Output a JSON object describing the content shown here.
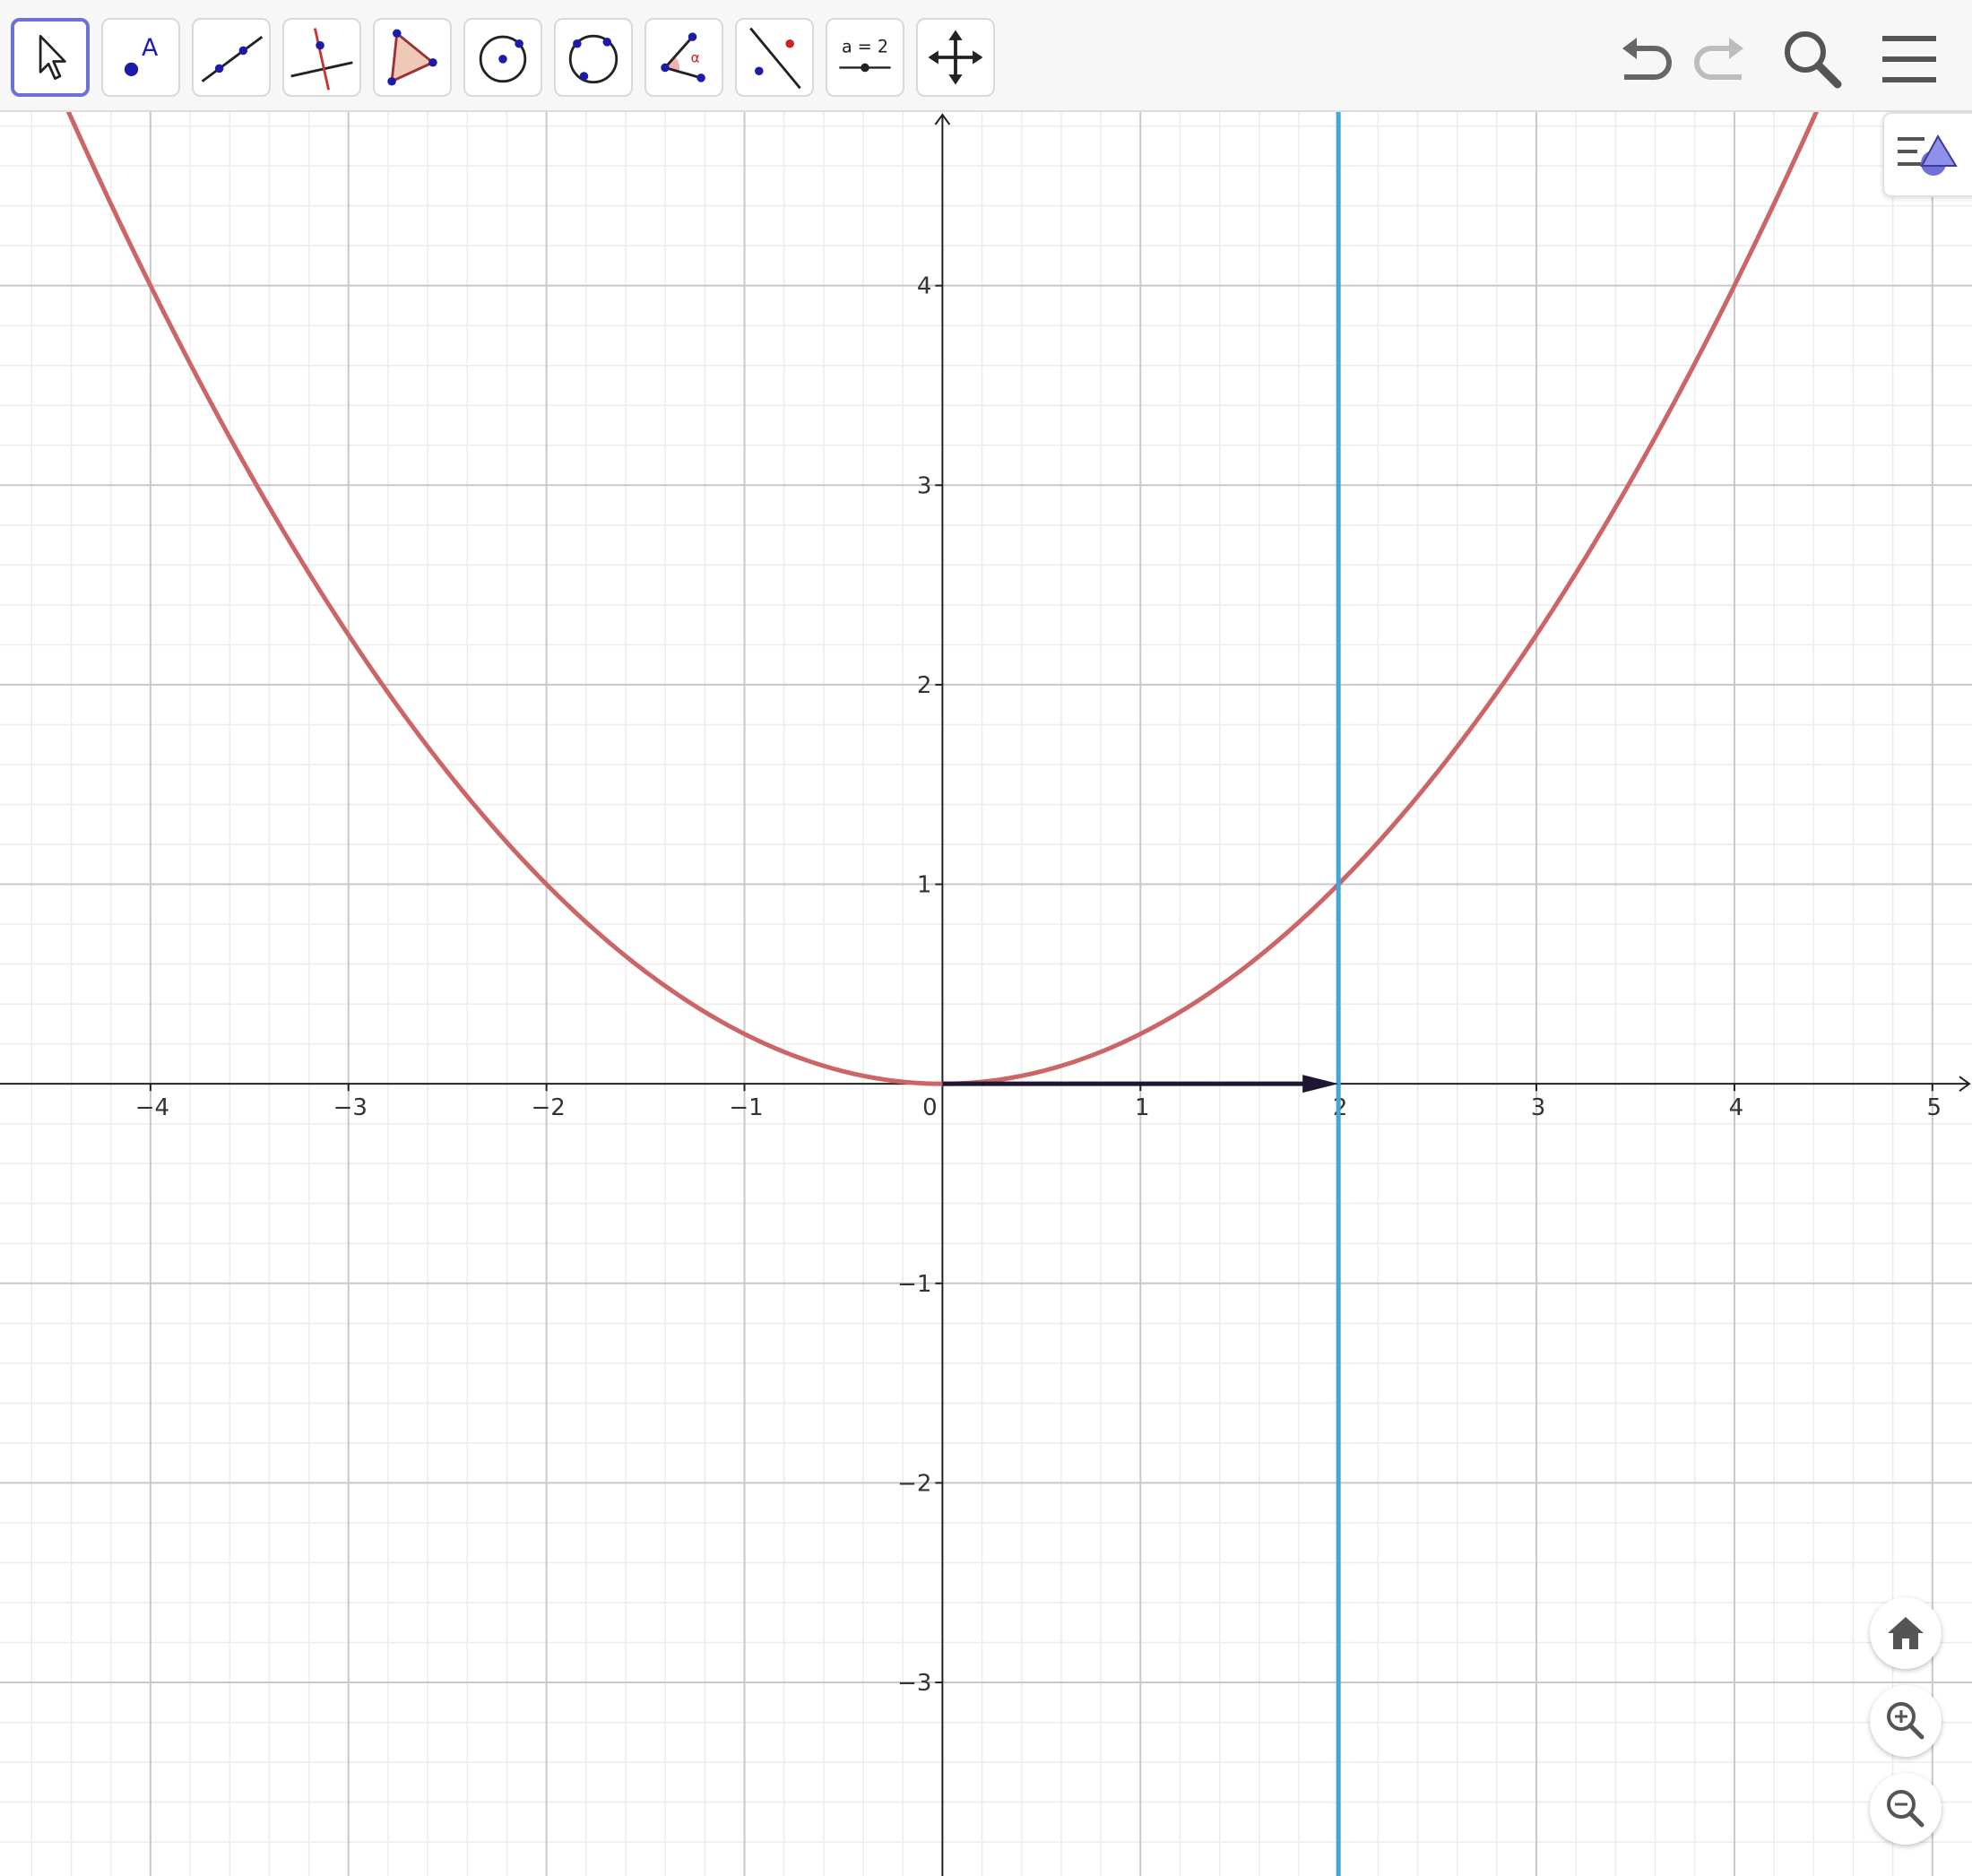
{
  "toolbar": {
    "tools": [
      {
        "name": "move-tool",
        "label": "",
        "icon": "arrow-cursor-icon"
      },
      {
        "name": "point-tool",
        "label": "A",
        "icon": "point-icon"
      },
      {
        "name": "line-tool",
        "label": "",
        "icon": "line-icon"
      },
      {
        "name": "perpendicular-line-tool",
        "label": "",
        "icon": "perpendicular-line-icon"
      },
      {
        "name": "polygon-tool",
        "label": "",
        "icon": "polygon-icon"
      },
      {
        "name": "circle-center-point-tool",
        "label": "",
        "icon": "circle-icon"
      },
      {
        "name": "circle-three-points-tool",
        "label": "",
        "icon": "circle-three-points-icon"
      },
      {
        "name": "angle-tool",
        "label": "α",
        "icon": "angle-icon"
      },
      {
        "name": "reflect-tool",
        "label": "",
        "icon": "reflect-icon"
      },
      {
        "name": "slider-tool",
        "label": "a = 2",
        "icon": "slider-icon"
      },
      {
        "name": "move-graphics-view-tool",
        "label": "",
        "icon": "move-arrows-icon"
      }
    ],
    "selected_tool": "move-tool",
    "right_buttons": [
      "undo-icon",
      "redo-icon",
      "search-icon",
      "menu-icon"
    ]
  },
  "graphics": {
    "x_ticks": [
      "−4",
      "−3",
      "−2",
      "−1",
      "0",
      "1",
      "2",
      "3",
      "4",
      "5"
    ],
    "y_ticks": [
      "4",
      "3",
      "2",
      "1",
      "−1",
      "−2",
      "−3"
    ],
    "x_range": [
      -4.76,
      5.2
    ],
    "y_range": [
      -3.97,
      4.87
    ],
    "grid": true,
    "objects": {
      "curve": {
        "type": "function",
        "expression": "x^2/4",
        "color": "#cc6666"
      },
      "vertical_line": {
        "type": "line",
        "x": 2,
        "color": "#45a5d8"
      },
      "vector": {
        "type": "vector",
        "from": [
          0,
          0
        ],
        "to": [
          2,
          0
        ],
        "color": "#1f1535"
      }
    }
  },
  "view_controls": [
    "home-icon",
    "zoom-in-icon",
    "zoom-out-icon"
  ],
  "style_bar_toggle": "style-bar-icon"
}
